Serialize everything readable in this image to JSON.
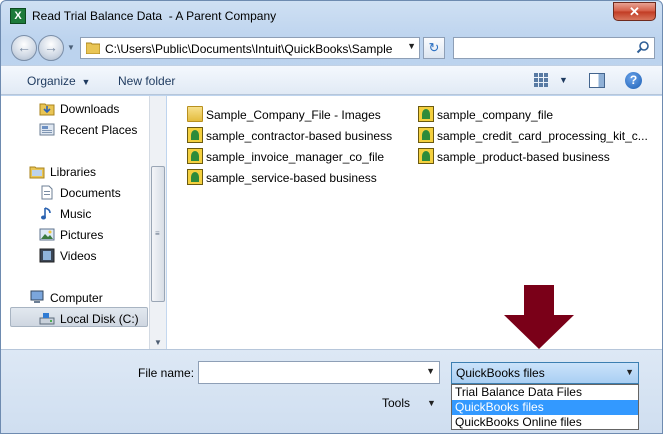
{
  "window": {
    "title": "Read Trial Balance Data  - A Parent Company",
    "app_icon": "X",
    "close_label": "✕"
  },
  "address": {
    "path": "C:\\Users\\Public\\Documents\\Intuit\\QuickBooks\\Sample",
    "search_placeholder": ""
  },
  "toolbar": {
    "organize": "Organize",
    "new_folder": "New folder"
  },
  "nav": {
    "downloads": "Downloads",
    "recent_places": "Recent Places",
    "libraries": "Libraries",
    "documents": "Documents",
    "music": "Music",
    "pictures": "Pictures",
    "videos": "Videos",
    "computer": "Computer",
    "local_disk": "Local Disk (C:)"
  },
  "files": [
    {
      "name": "Sample_Company_File - Images",
      "icon": "folder-icon"
    },
    {
      "name": "sample_company_file",
      "icon": "quickbooks-file-icon"
    },
    {
      "name": "sample_contractor-based business",
      "icon": "quickbooks-file-icon"
    },
    {
      "name": "sample_credit_card_processing_kit_c...",
      "icon": "quickbooks-file-icon"
    },
    {
      "name": "sample_invoice_manager_co_file",
      "icon": "quickbooks-file-icon"
    },
    {
      "name": "sample_product-based business",
      "icon": "quickbooks-file-icon"
    },
    {
      "name": "sample_service-based business",
      "icon": "quickbooks-file-icon"
    }
  ],
  "bottom": {
    "file_name_label": "File name:",
    "file_name_value": "",
    "file_type_selected": "QuickBooks files",
    "tools_label": "Tools"
  },
  "file_type_options": [
    {
      "label": "Trial Balance Data Files",
      "selected": false
    },
    {
      "label": "QuickBooks files",
      "selected": true
    },
    {
      "label": "QuickBooks Online files",
      "selected": false
    }
  ],
  "colors": {
    "arrow": "#7a0018",
    "selection": "#3399ff"
  }
}
